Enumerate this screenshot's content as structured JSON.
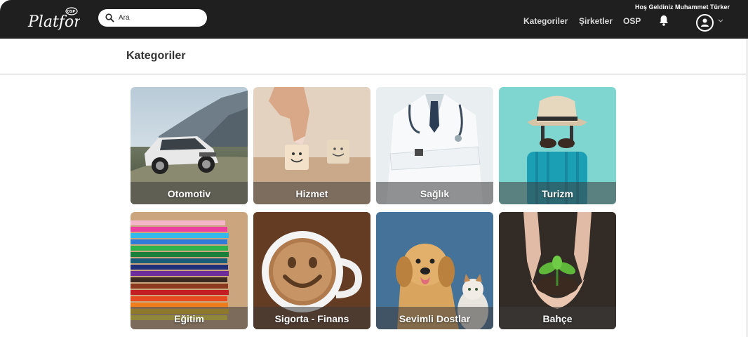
{
  "header": {
    "logo_text": "Platform",
    "logo_badge": "OSP",
    "search": {
      "placeholder": "Ara"
    },
    "welcome": "Hoş Geldiniz Muhammet Türker",
    "nav": [
      {
        "label": "Kategoriler"
      },
      {
        "label": "Şirketler"
      },
      {
        "label": "OSP"
      }
    ],
    "icons": [
      "search-icon",
      "bell-icon",
      "user-icon",
      "chevron-down-icon"
    ]
  },
  "page": {
    "title": "Kategoriler"
  },
  "categories": [
    {
      "label": "Otomotiv"
    },
    {
      "label": "Hizmet"
    },
    {
      "label": "Sağlık"
    },
    {
      "label": "Turizm"
    },
    {
      "label": "Eğitim"
    },
    {
      "label": "Sigorta - Finans"
    },
    {
      "label": "Sevimli Dostlar"
    },
    {
      "label": "Bahçe"
    }
  ],
  "colors": {
    "topbar": "#1f1f1f",
    "label_band": "#3c3c3c",
    "text": "#333333"
  }
}
